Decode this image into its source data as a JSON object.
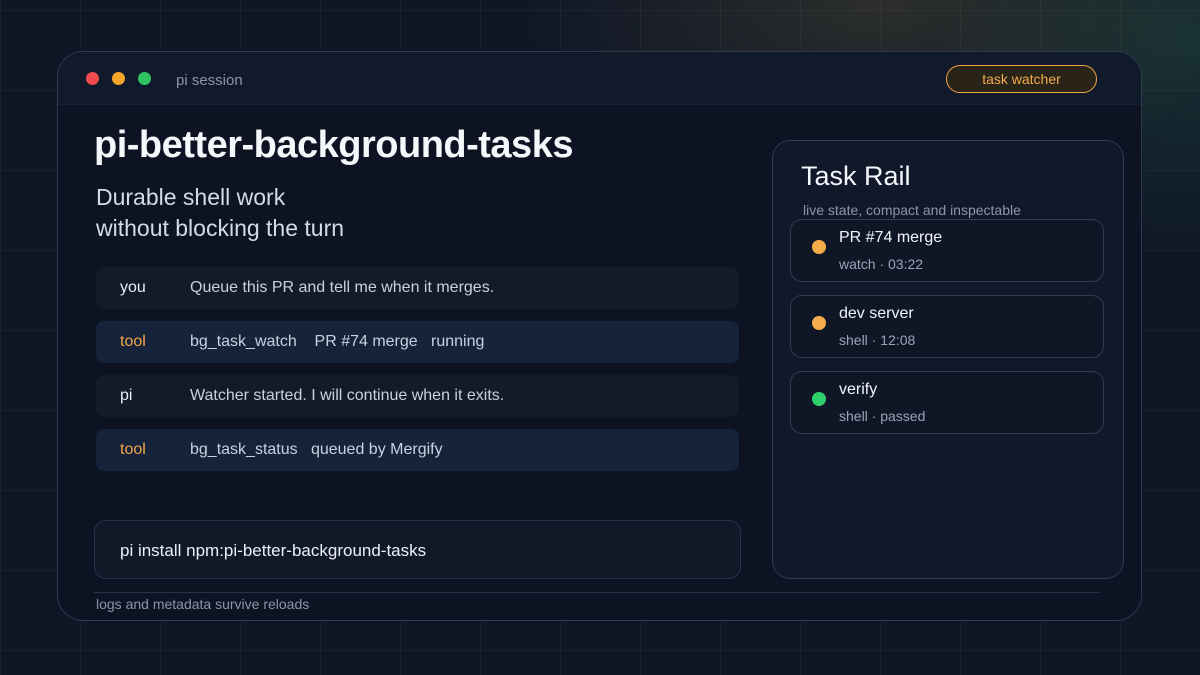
{
  "window": {
    "session_label": "pi session",
    "badge_label": "task watcher"
  },
  "hero": {
    "title": "pi-better-background-tasks",
    "subtitle_line1": "Durable shell work",
    "subtitle_line2": "without blocking the turn"
  },
  "transcript": [
    {
      "role": "you",
      "kind": "user",
      "text": "Queue this PR and tell me when it merges."
    },
    {
      "role": "tool",
      "kind": "tool",
      "text": "bg_task_watch    PR #74 merge   running"
    },
    {
      "role": "pi",
      "kind": "assistant",
      "text": "Watcher started. I will continue when it exits."
    },
    {
      "role": "tool",
      "kind": "tool",
      "text": "bg_task_status   queued by Mergify"
    }
  ],
  "install_command": "pi install npm:pi-better-background-tasks",
  "footer_note": "logs and metadata survive reloads",
  "rail": {
    "title": "Task Rail",
    "subtitle": "live state, compact and inspectable",
    "tasks": [
      {
        "name": "PR #74 merge",
        "meta": "watch · 03:22",
        "status_color": "#f4ad4a"
      },
      {
        "name": "dev server",
        "meta": "shell · 12:08",
        "status_color": "#f4ad4a"
      },
      {
        "name": "verify",
        "meta": "shell · passed",
        "status_color": "#2fcf6c"
      }
    ]
  },
  "colors": {
    "accent_orange": "#f2a64a",
    "status_green": "#2fcf6c",
    "window_red": "#ef4a4e",
    "window_yellow": "#f4a52b",
    "window_green": "#2fc462"
  }
}
